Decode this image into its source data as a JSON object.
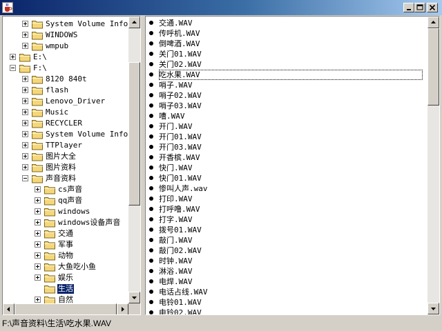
{
  "window": {
    "icon": "java-coffee-cup-icon",
    "buttons": [
      "minimize-icon",
      "maximize-icon",
      "close-icon"
    ]
  },
  "tree": {
    "items": [
      {
        "label": "System Volume Inform",
        "depth": 1,
        "toggle": "plus"
      },
      {
        "label": "WINDOWS",
        "depth": 1,
        "toggle": "plus"
      },
      {
        "label": "wmpub",
        "depth": 1,
        "toggle": "plus"
      },
      {
        "label": "E:\\",
        "depth": 0,
        "toggle": "plus"
      },
      {
        "label": "F:\\",
        "depth": 0,
        "toggle": "minus"
      },
      {
        "label": "8120 840t",
        "depth": 1,
        "toggle": "plus"
      },
      {
        "label": "flash",
        "depth": 1,
        "toggle": "plus"
      },
      {
        "label": "Lenovo_Driver",
        "depth": 1,
        "toggle": "plus"
      },
      {
        "label": "Music",
        "depth": 1,
        "toggle": "plus"
      },
      {
        "label": "RECYCLER",
        "depth": 1,
        "toggle": "plus"
      },
      {
        "label": "System Volume Inform",
        "depth": 1,
        "toggle": "plus"
      },
      {
        "label": "TTPlayer",
        "depth": 1,
        "toggle": "plus"
      },
      {
        "label": "图片大全",
        "depth": 1,
        "toggle": "plus"
      },
      {
        "label": "图片资料",
        "depth": 1,
        "toggle": "plus"
      },
      {
        "label": "声音资料",
        "depth": 1,
        "toggle": "minus"
      },
      {
        "label": "cs声音",
        "depth": 2,
        "toggle": "plus"
      },
      {
        "label": "qq声音",
        "depth": 2,
        "toggle": "plus"
      },
      {
        "label": "windows",
        "depth": 2,
        "toggle": "plus"
      },
      {
        "label": "windows设备声音",
        "depth": 2,
        "toggle": "plus"
      },
      {
        "label": "交通",
        "depth": 2,
        "toggle": "plus"
      },
      {
        "label": "军事",
        "depth": 2,
        "toggle": "plus"
      },
      {
        "label": "动物",
        "depth": 2,
        "toggle": "plus"
      },
      {
        "label": "大鱼吃小鱼",
        "depth": 2,
        "toggle": "plus"
      },
      {
        "label": "娱乐",
        "depth": 2,
        "toggle": "plus"
      },
      {
        "label": "生活",
        "depth": 2,
        "toggle": "none",
        "selected": true
      },
      {
        "label": "自然",
        "depth": 2,
        "toggle": "plus"
      }
    ]
  },
  "files": {
    "focused_index": 5,
    "items": [
      "交通.WAV",
      "传呼机.WAV",
      "倒啤酒.WAV",
      "关门01.WAV",
      "关门02.WAV",
      "吃水果.WAV",
      "哨子.WAV",
      "哨子02.WAV",
      "哨子03.WAV",
      "嘈.WAV",
      "开门.WAV",
      "开门01.WAV",
      "开门03.WAV",
      "开香槟.WAV",
      "快门.WAV",
      "快门01.WAV",
      "惨叫人声.wav",
      "打印.WAV",
      "打呼噜.WAV",
      "打字.WAV",
      "拨号01.WAV",
      "敲门.WAV",
      "敲门02.WAV",
      "时钟.WAV",
      "淋浴.WAV",
      "电焊.WAV",
      "电话占线.WAV",
      "电铃01.WAV",
      "电铃02.WAV"
    ]
  },
  "scrollbars": {
    "tree_vertical_position": 0.28,
    "tree_horizontal_position": 0.0,
    "list_vertical_position": 0.0
  },
  "status": {
    "path": "F:\\声音资料\\生活\\吃水果.WAV"
  },
  "colors": {
    "title_bar_start": "#0a246a",
    "title_bar_end": "#a6caf0",
    "selection": "#0a246a",
    "folder_fill": "#f5d77a",
    "window_face": "#d4d0c8"
  }
}
